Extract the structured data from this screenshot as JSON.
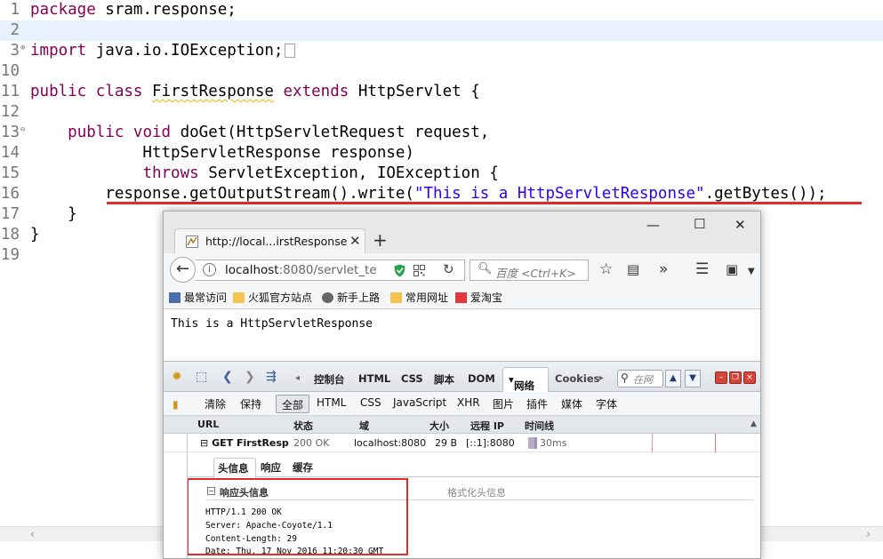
{
  "editor": {
    "lines": [
      {
        "n": "1",
        "parts": [
          {
            "t": "package",
            "c": "kw"
          },
          {
            "t": " sram.response;",
            "c": ""
          }
        ]
      },
      {
        "n": "2",
        "parts": []
      },
      {
        "n": "3",
        "parts": [
          {
            "t": "import",
            "c": "kw"
          },
          {
            "t": " java.io.IOException;",
            "c": ""
          }
        ]
      },
      {
        "n": "10",
        "parts": []
      },
      {
        "n": "11",
        "parts": [
          {
            "t": "public",
            "c": "kw"
          },
          {
            "t": " ",
            "c": ""
          },
          {
            "t": "class",
            "c": "kw"
          },
          {
            "t": " ",
            "c": ""
          },
          {
            "t": "FirstResponse",
            "c": "warn"
          },
          {
            "t": " ",
            "c": ""
          },
          {
            "t": "extends",
            "c": "kw"
          },
          {
            "t": " HttpServlet {",
            "c": ""
          }
        ]
      },
      {
        "n": "12",
        "parts": []
      },
      {
        "n": "13",
        "parts": [
          {
            "t": "    ",
            "c": ""
          },
          {
            "t": "public",
            "c": "kw"
          },
          {
            "t": " ",
            "c": ""
          },
          {
            "t": "void",
            "c": "kw"
          },
          {
            "t": " doGet(HttpServletRequest request,",
            "c": ""
          }
        ]
      },
      {
        "n": "14",
        "parts": [
          {
            "t": "            HttpServletResponse response)",
            "c": ""
          }
        ]
      },
      {
        "n": "15",
        "parts": [
          {
            "t": "            ",
            "c": ""
          },
          {
            "t": "throws",
            "c": "kw"
          },
          {
            "t": " ServletException, IOException {",
            "c": ""
          }
        ]
      },
      {
        "n": "16",
        "parts": [
          {
            "t": "        response.getOutputStream().write(",
            "c": ""
          },
          {
            "t": "\"This is a HttpServletResponse\"",
            "c": "str"
          },
          {
            "t": ".getBytes());",
            "c": ""
          }
        ]
      },
      {
        "n": "17",
        "parts": [
          {
            "t": "    }",
            "c": ""
          }
        ]
      },
      {
        "n": "18",
        "parts": [
          {
            "t": "}",
            "c": ""
          }
        ]
      },
      {
        "n": "19",
        "parts": []
      }
    ]
  },
  "browser": {
    "tab_title": "http://local...irstResponse",
    "url_host": "localhost",
    "url_rest": ":8080/servlet_te",
    "search_placeholder": "百度 <Ctrl+K>",
    "bookmarks": [
      "最常访问",
      "火狐官方站点",
      "新手上路",
      "常用网址",
      "爱淘宝"
    ],
    "page_text": "This is a HttpServletResponse"
  },
  "firebug": {
    "tabs": [
      "控制台",
      "HTML",
      "CSS",
      "脚本",
      "DOM",
      "网络",
      "Cookies"
    ],
    "search_placeholder": "在网",
    "filters": [
      "清除",
      "保持",
      "全部",
      "HTML",
      "CSS",
      "JavaScript",
      "XHR",
      "图片",
      "插件",
      "媒体",
      "字体"
    ],
    "columns": [
      "URL",
      "状态",
      "域",
      "大小",
      "远程 IP",
      "时间线"
    ],
    "request": {
      "url": "GET FirstResp",
      "status": "200 OK",
      "domain": "localhost:8080",
      "size": "29 B",
      "remote_ip": "[::1]:8080",
      "time": "30ms",
      "timeline_fraction": 0.04
    },
    "detail_tabs": [
      "头信息",
      "响应",
      "缓存"
    ],
    "response_headers_title": "响应头信息",
    "format_link": "格式化头信息",
    "raw_headers": [
      "HTTP/1.1 200 OK",
      "Server: Apache-Coyote/1.1",
      "Content-Length: 29",
      "Date: Thu, 17 Nov 2016 11:20:30 GMT"
    ]
  },
  "colors": {
    "keyword": "#7f0055",
    "string": "#2a00ff",
    "highlight": "#e22b2b"
  }
}
